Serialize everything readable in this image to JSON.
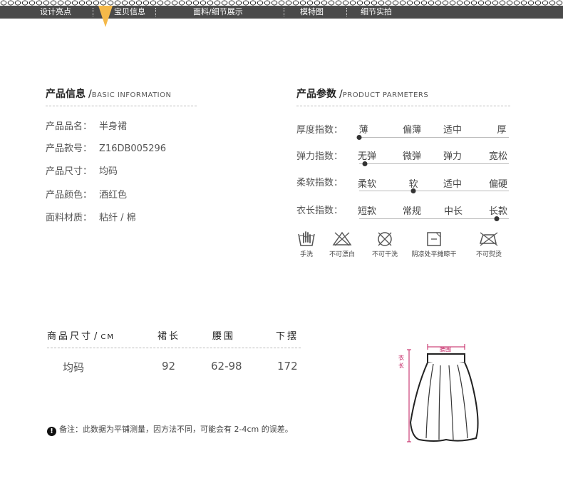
{
  "nav": {
    "items": [
      "设计亮点",
      "宝贝信息",
      "面料/细节展示",
      "模特图",
      "细节实拍"
    ],
    "active": "宝贝信息"
  },
  "info": {
    "title": "产品信息",
    "slash": "/",
    "subtitle": "BASIC INFORMATION",
    "rows": [
      {
        "label": "产品品名：",
        "value": "半身裙"
      },
      {
        "label": "产品款号：",
        "value": "Z16DB005296"
      },
      {
        "label": "产品尺寸：",
        "value": "均码"
      },
      {
        "label": "产品颜色：",
        "value": "酒红色"
      },
      {
        "label": "面料材质：",
        "value": "粘纤 / 棉"
      }
    ]
  },
  "params": {
    "title": "产品参数",
    "slash": "/",
    "subtitle": "PRODUCT PARMETERS",
    "rows": [
      {
        "label": "厚度指数：",
        "options": [
          "薄",
          "偏薄",
          "适中",
          "厚"
        ],
        "level": 0.0
      },
      {
        "label": "弹力指数：",
        "options": [
          "无弹",
          "微弹",
          "弹力",
          "宽松"
        ],
        "level": 0.04
      },
      {
        "label": "柔软指数：",
        "options": [
          "柔软",
          "软",
          "适中",
          "偏硬"
        ],
        "level": 0.36
      },
      {
        "label": "衣长指数：",
        "options": [
          "短款",
          "常规",
          "中长",
          "长款"
        ],
        "level": 0.92
      }
    ]
  },
  "care": [
    {
      "icon": "hand-wash-icon",
      "label": "手洗"
    },
    {
      "icon": "no-bleach-icon",
      "label": "不可漂白"
    },
    {
      "icon": "no-dry-clean-icon",
      "label": "不可干洗"
    },
    {
      "icon": "shade-dry-icon",
      "label": "阴凉处平摊晾干"
    },
    {
      "icon": "no-iron-icon",
      "label": "不可熨烫"
    }
  ],
  "size_table": {
    "title": "商品尺寸",
    "slash": "/",
    "unit": "CM",
    "headers": [
      "裙长",
      "腰围",
      "下摆"
    ],
    "row": {
      "size": "均码",
      "values": [
        "92",
        "62-98",
        "172"
      ]
    }
  },
  "note": {
    "icon": "!",
    "text": "备注：此数据为平铺测量，因方法不同，可能会有 2-4cm 的误差。"
  },
  "diagram": {
    "waist_label": "腰围",
    "length_label": "衣长",
    "accent": "#c2185b"
  },
  "colors": {
    "nav_bg": "#4a4a4a",
    "nav_marker": "#f5b94a",
    "knob": "#333333"
  }
}
